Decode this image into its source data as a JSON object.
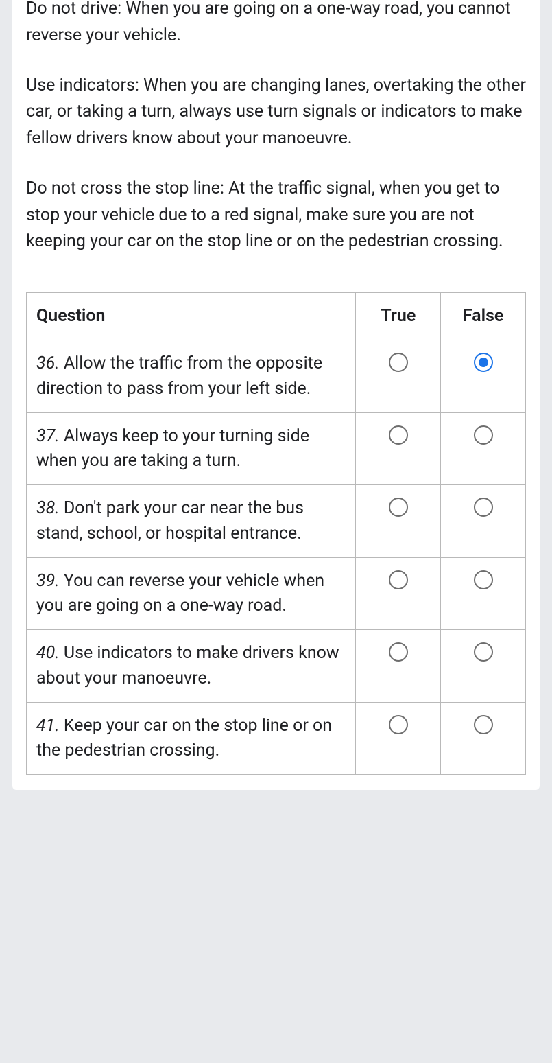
{
  "paragraphs": [
    "Do not drive: When you are going on a one-way road, you cannot reverse your vehicle.",
    "Use indicators: When you are changing lanes, overtaking the other car, or taking a turn, always use turn signals or indicators to make fellow drivers know about your manoeuvre.",
    "Do not cross the stop line: At the traffic signal, when you get to stop your vehicle due to a red signal, make sure you are not keeping your car on the stop line or on the pedestrian crossing."
  ],
  "table": {
    "headers": {
      "question": "Question",
      "true": "True",
      "false": "False"
    },
    "rows": [
      {
        "num": "36.",
        "text": "Allow the traffic from the opposite direction to pass from your left side.",
        "selected": "false"
      },
      {
        "num": "37.",
        "text": "Always keep to your turning side when you are taking a turn.",
        "selected": ""
      },
      {
        "num": "38.",
        "text": "Don't park your car near the bus stand, school, or hospital entrance.",
        "selected": ""
      },
      {
        "num": "39.",
        "text": "You can reverse your vehicle when you are going on a one-way road.",
        "selected": ""
      },
      {
        "num": "40.",
        "text": "Use indicators to make drivers know about your manoeuvre.",
        "selected": ""
      },
      {
        "num": "41.",
        "text": "Keep your car on the stop line or on the pedestrian crossing.",
        "selected": ""
      }
    ]
  }
}
